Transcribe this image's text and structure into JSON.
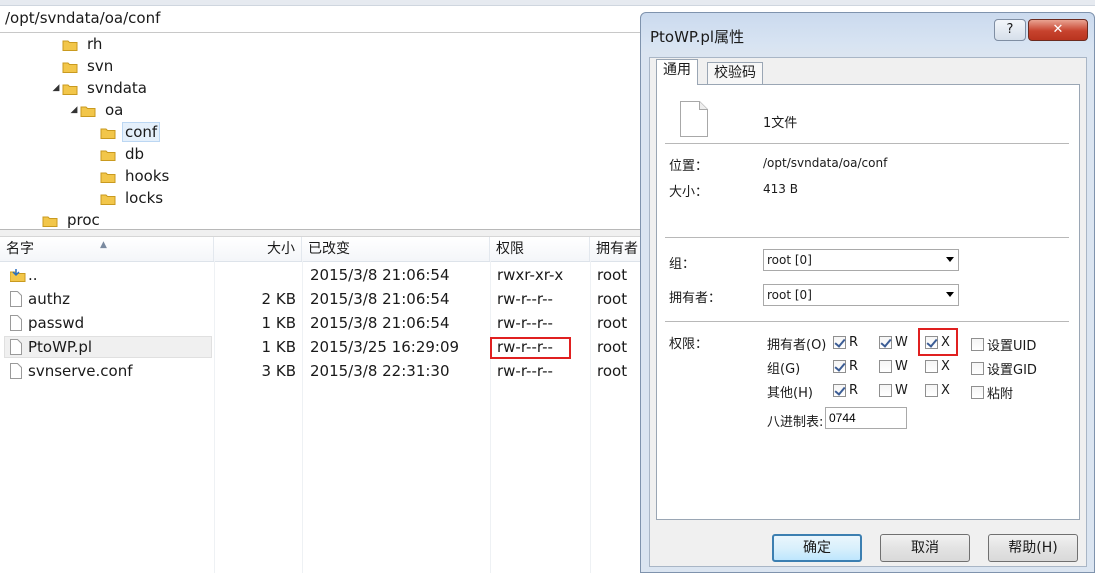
{
  "path_bar": "/opt/svndata/oa/conf",
  "tree": [
    {
      "label": "rh",
      "arrow": ""
    },
    {
      "label": "svn",
      "arrow": ""
    },
    {
      "label": "svndata",
      "arrow": "◢"
    },
    {
      "label": "oa",
      "arrow": "◢"
    },
    {
      "label": "conf",
      "arrow": ""
    },
    {
      "label": "db",
      "arrow": ""
    },
    {
      "label": "hooks",
      "arrow": ""
    },
    {
      "label": "locks",
      "arrow": ""
    },
    {
      "label": "proc",
      "arrow": ""
    }
  ],
  "columns": [
    "名字",
    "大小",
    "已改变",
    "权限",
    "拥有者"
  ],
  "files": [
    {
      "name": "..",
      "size": "",
      "modified": "2015/3/8 21:06:54",
      "perm": "rwxr-xr-x",
      "owner": "root"
    },
    {
      "name": "authz",
      "size": "2 KB",
      "modified": "2015/3/8 21:06:54",
      "perm": "rw-r--r--",
      "owner": "root"
    },
    {
      "name": "passwd",
      "size": "1 KB",
      "modified": "2015/3/8 21:06:54",
      "perm": "rw-r--r--",
      "owner": "root"
    },
    {
      "name": "PtoWP.pl",
      "size": "1 KB",
      "modified": "2015/3/25 16:29:09",
      "perm": "rw-r--r--",
      "owner": "root"
    },
    {
      "name": "svnserve.conf",
      "size": "3 KB",
      "modified": "2015/3/8 22:31:30",
      "perm": "rw-r--r--",
      "owner": "root"
    }
  ],
  "dialog": {
    "title": "PtoWP.pl属性",
    "help_btn": "?",
    "close_btn": "✕",
    "tabs": [
      "通用",
      "校验码"
    ],
    "file_count": "1文件",
    "location_label": "位置：",
    "location_value": "/opt/svndata/oa/conf",
    "size_label": "大小：",
    "size_value": "413 B",
    "group_label": "组：",
    "group_value": "root [0]",
    "owner_label": "拥有者：",
    "owner_value": "root [0]",
    "perm_label": "权限：",
    "rows": [
      {
        "label": "拥有者(O)",
        "r": true,
        "w": true,
        "x": true,
        "extra_label": "设置UID",
        "extra": false
      },
      {
        "label": "组(G)",
        "r": true,
        "w": false,
        "x": false,
        "extra_label": "设置GID",
        "extra": false
      },
      {
        "label": "其他(H)",
        "r": true,
        "w": false,
        "x": false,
        "extra_label": "粘附",
        "extra": false
      }
    ],
    "flag_labels": {
      "r": "R",
      "w": "W",
      "x": "X"
    },
    "octal_label": "八进制表:",
    "octal_value": "0744",
    "buttons": {
      "ok": "确定",
      "cancel": "取消",
      "help": "帮助(H)"
    }
  },
  "highlight_color": "#e02020"
}
